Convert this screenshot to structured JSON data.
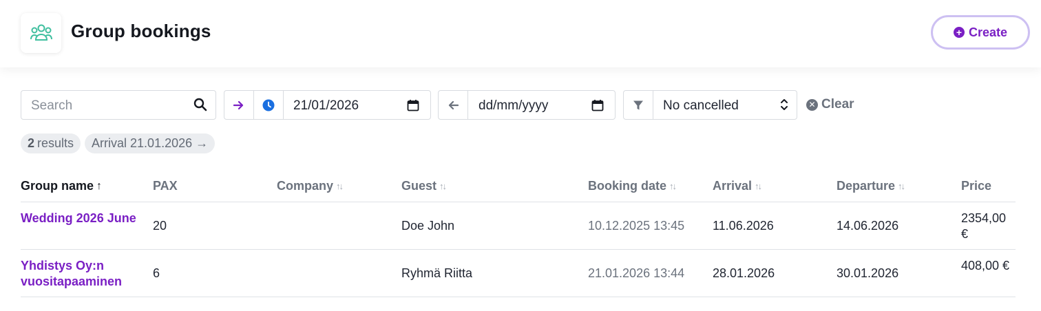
{
  "header": {
    "title": "Group bookings",
    "app_icon": "group-people-icon",
    "create_label": "Create",
    "accent": "#7a1fc4",
    "icon_color": "#3fbf9f"
  },
  "filters": {
    "search_placeholder": "Search",
    "arrival_date": "21/01/2026",
    "departure_date": "dd/mm/yyyy",
    "status_value": "No cancelled",
    "clear_label": "Clear"
  },
  "chips": {
    "results_count": "2",
    "results_label": "results",
    "arrival_chip": "Arrival 21.01.2026 →"
  },
  "table": {
    "columns": [
      {
        "label": "Group name",
        "sort": "↑"
      },
      {
        "label": "PAX",
        "sort": ""
      },
      {
        "label": "Company",
        "sort": "↑↓"
      },
      {
        "label": "Guest",
        "sort": "↑↓"
      },
      {
        "label": "Booking date",
        "sort": "↑↓"
      },
      {
        "label": "Arrival",
        "sort": "↑↓"
      },
      {
        "label": "Departure",
        "sort": "↑↓"
      },
      {
        "label": "Price",
        "sort": ""
      }
    ],
    "rows": [
      {
        "group_name": "Wedding 2026 June",
        "pax": "20",
        "company": "",
        "guest": "Doe John",
        "booking_date": "10.12.2025 13:45",
        "arrival": "11.06.2026",
        "departure": "14.06.2026",
        "price": "2354,00 €"
      },
      {
        "group_name": "Yhdistys Oy:n vuositapaaminen",
        "pax": "6",
        "company": "",
        "guest": "Ryhmä Riitta",
        "booking_date": "21.01.2026 13:44",
        "arrival": "28.01.2026",
        "departure": "30.01.2026",
        "price": "408,00 €"
      }
    ]
  }
}
